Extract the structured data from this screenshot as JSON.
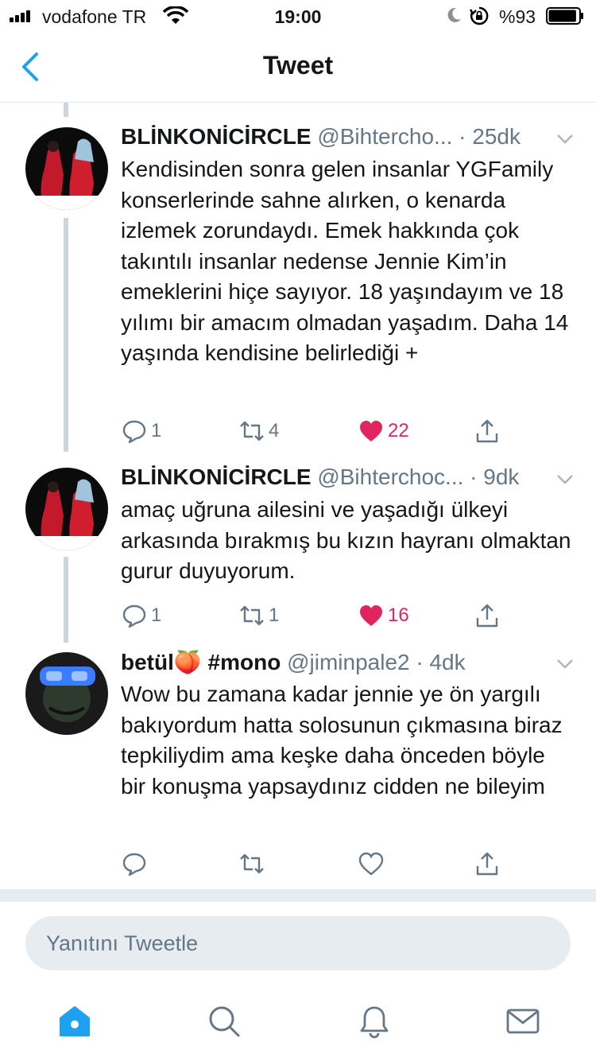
{
  "status_bar": {
    "carrier": "vodafone TR",
    "time": "19:00",
    "battery": "%93",
    "battery_level": 0.93
  },
  "nav": {
    "title": "Tweet"
  },
  "tweets": [
    {
      "name": "BLİNKONİCİRCLE",
      "handle": "@Bihtercho...",
      "time": "25dk",
      "text": "Kendisinden sonra gelen insanlar YGFamily konserlerinde sahne alırken, o kenarda izlemek zorundaydı. Emek hakkında çok takıntılı insanlar nedense Jennie Kim’in emeklerini hiçe sayıyor. 18 yaşındayım ve 18 yılımı bir amacım olmadan yaşadım. Daha 14 yaşında kendisine belirlediği +",
      "replies": "1",
      "retweets": "4",
      "likes": "22"
    },
    {
      "name": "BLİNKONİCİRCLE",
      "handle": "@Bihterchoc...",
      "time": "9dk",
      "text": "amaç uğruna ailesini ve yaşadığı ülkeyi arkasında bırakmış bu kızın hayranı olmaktan gurur duyuyorum.",
      "replies": "1",
      "retweets": "1",
      "likes": "16"
    },
    {
      "name": "betül🍑 #mono",
      "handle": "@jiminpale2",
      "time": "4dk",
      "text": "Wow bu zamana kadar jennie ye ön yargılı bakıyordum hatta solosunun çıkmasına biraz tepkiliydim ama keşke daha önceden böyle bir konuşma yapsaydınız cidden ne bileyim",
      "replies": "",
      "retweets": "",
      "likes": ""
    }
  ],
  "reply": {
    "placeholder": "Yanıtını Tweetle"
  },
  "tabs": [
    "home-icon",
    "search-icon",
    "notifications-icon",
    "messages-icon"
  ],
  "colors": {
    "accent": "#1da1f2",
    "like": "#e0245e",
    "muted": "#657786"
  }
}
